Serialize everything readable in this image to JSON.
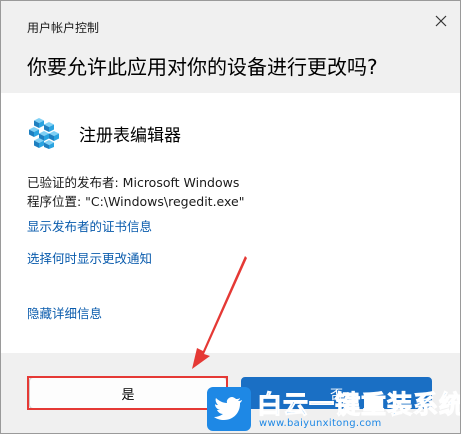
{
  "window": {
    "title": "用户帐户控制",
    "question": "你要允许此应用对你的设备进行更改吗?"
  },
  "app": {
    "name": "注册表编辑器",
    "icon": "regedit-cubes-icon",
    "publisher_line": "已验证的发布者: Microsoft Windows",
    "location_line": "程序位置: \"C:\\Windows\\regedit.exe\""
  },
  "links": {
    "show_cert": "显示发布者的证书信息",
    "change_notify": "选择何时显示更改通知",
    "hide_details": "隐藏详细信息"
  },
  "buttons": {
    "yes": "是",
    "no": "否"
  },
  "watermark": {
    "brand": "白云一键重装系统",
    "url": "www.baiyunxitong.com"
  },
  "colors": {
    "link": "#0b5cad",
    "primary_button": "#1a6fc4",
    "highlight": "#e53935",
    "watermark": "#1e88e5"
  }
}
